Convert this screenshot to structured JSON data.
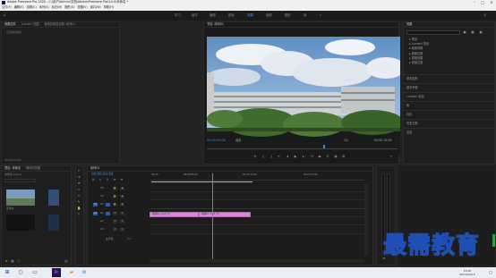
{
  "window": {
    "title": "Adobe Premiere Pro 2020 - C:\\用户\\Admin\\文档\\Adobe\\Premiere Pro\\14.0\\未命名 *",
    "min": "–",
    "max": "□",
    "close": "✕"
  },
  "menu": [
    "文件(F)",
    "编辑(E)",
    "剪辑(C)",
    "序列(S)",
    "标记(M)",
    "图形(G)",
    "视图(V)",
    "窗口(W)",
    "帮助(H)"
  ],
  "workspaces": {
    "home_icon": "home-icon",
    "items": [
      "学习",
      "组件",
      "编辑",
      "颜色",
      "效果",
      "音频",
      "图形",
      "库"
    ],
    "active": "效果",
    "more": "»"
  },
  "source_panel": {
    "tabs": [
      "效果控件",
      "Lumetri 范围",
      "音频剪辑混合器: 序列01"
    ],
    "active": "效果控件",
    "clip_label": "（无剪辑选择）",
    "timecode": "00:00:00:00"
  },
  "program_monitor": {
    "title": "节目: 序列01",
    "timecode_left": "00:00:04:04",
    "fit": "适合",
    "quality": "1/2",
    "timecode_right": "00:00:10:06"
  },
  "effects_panel": {
    "title": "效果",
    "search_placeholder": "",
    "tree": [
      "预设",
      "Lumetri 预设",
      "音频效果",
      "音频过渡",
      "视频效果",
      "视频过渡"
    ],
    "sections": [
      "基本图形",
      "基本声音",
      "Lumetri 颜色",
      "库",
      "标记",
      "历史记录",
      "信息"
    ]
  },
  "project_panel": {
    "tabs": [
      "项目: 未命名",
      "媒体浏览器"
    ],
    "file": "未命名.prproj",
    "items": [
      {
        "name": "序列01",
        "duration": "10:06"
      },
      {
        "name": "视频01.mp4",
        "duration": ""
      },
      {
        "name": "",
        "duration": ""
      },
      {
        "name": "",
        "duration": ""
      }
    ]
  },
  "timeline": {
    "tab": "序列01",
    "timecode": "00:00:04:04",
    "ruler": [
      "00:00",
      "00:00:05:00",
      "00:00:10:00",
      "00:00:15:00"
    ],
    "tracks": [
      "V3",
      "V2",
      "V1",
      "A1",
      "A2",
      "A3"
    ],
    "master": "主声道",
    "master_value": "0.0",
    "clips": [
      {
        "label": "视频01.mp4 [V]"
      },
      {
        "label": "视频01.mp4 [V]"
      }
    ],
    "meter_label": "dB"
  },
  "taskbar": {
    "start": "windows-icon",
    "clock_time": "15:00",
    "clock_date": "2021/10/15"
  },
  "watermark": "最需教育"
}
